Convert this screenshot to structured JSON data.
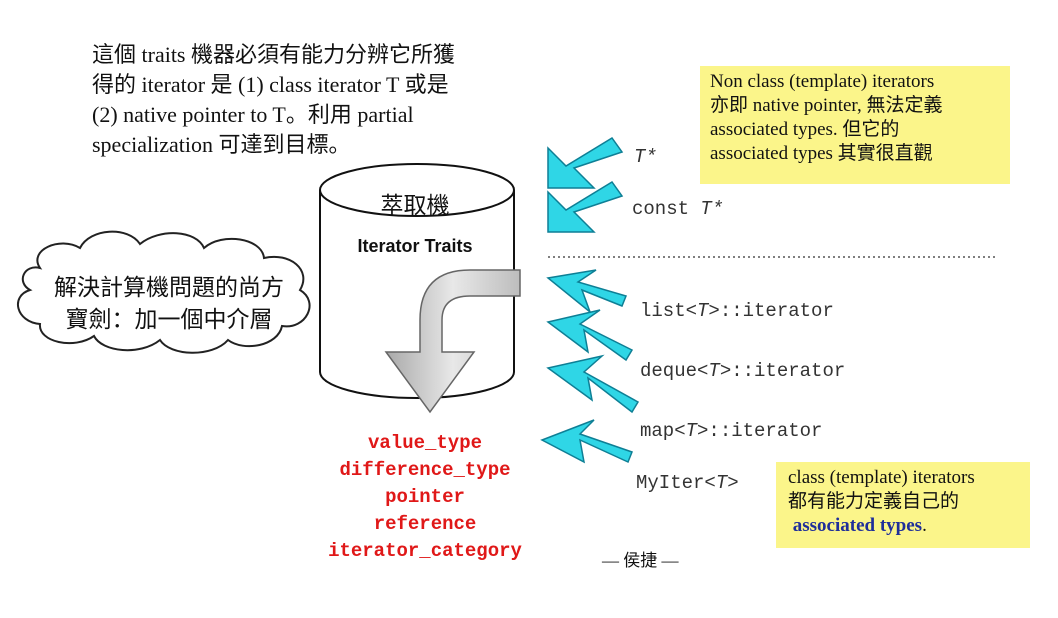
{
  "intro": {
    "lines": [
      "這個 traits 機器必須有能力分辨它所獲",
      "得的 iterator 是 (1) class iterator T 或是",
      "(2) native pointer to T。利用 partial",
      "specialization 可達到目標。"
    ]
  },
  "note_top": {
    "lines": [
      "Non class (template) iterators",
      "亦即 native pointer, 無法定義",
      "associated types. 但它的",
      "associated types 其實很直觀"
    ]
  },
  "note_bottom": {
    "line1": "class (template) iterators",
    "line2": "都有能力定義自己的",
    "line3": "associated types",
    "line3_suffix": "."
  },
  "cloud": {
    "line1": "解決計算機問題的尚方",
    "line2": "寶劍：加一個中介層"
  },
  "drum": {
    "title": "萃取機",
    "subtitle": "Iterator Traits"
  },
  "pointer_types": {
    "t_ptr": "T*",
    "const_prefix": "const ",
    "const_T": "T*"
  },
  "class_iterators": [
    {
      "prefix": "list<",
      "param": "T",
      "suffix": ">::iterator"
    },
    {
      "prefix": "deque<",
      "param": "T",
      "suffix": ">::iterator"
    },
    {
      "prefix": "map<",
      "param": "T",
      "suffix": ">::iterator"
    },
    {
      "prefix": "MyIter<",
      "param": "T",
      "suffix": ">"
    }
  ],
  "trait_outputs": [
    "value_type",
    "difference_type",
    "pointer",
    "reference",
    "iterator_category"
  ],
  "author": "— 侯捷 —",
  "colors": {
    "arrow": "#2fd6e6",
    "arrow_dark": "#0e8fa5",
    "note_bg": "#fbf58a",
    "trait_text": "#e01818",
    "accent_blue": "#1f2e9a"
  }
}
